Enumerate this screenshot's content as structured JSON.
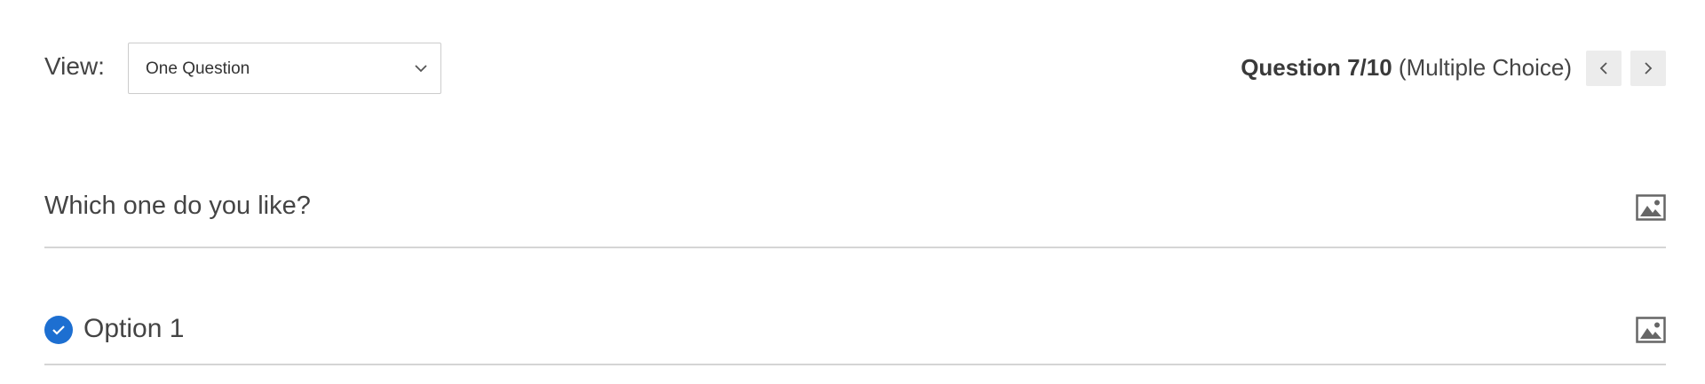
{
  "toolbar": {
    "view_label": "View:",
    "view_select": {
      "selected": "One Question"
    },
    "question_indicator": {
      "prefix": "Question 7/10",
      "type": "(Multiple Choice)"
    },
    "nav": {
      "prev_icon": "chevron-left-icon",
      "next_icon": "chevron-right-icon"
    }
  },
  "question": {
    "text": "Which one do you like?",
    "image_icon": "image-icon"
  },
  "options": [
    {
      "text": "Option 1",
      "selected": true,
      "check_icon": "check-circle-icon",
      "image_icon": "image-icon"
    }
  ],
  "colors": {
    "accent": "#1d6fd1",
    "text": "#444444",
    "divider": "#d5d5d5",
    "nav_button_bg": "#ececec"
  }
}
